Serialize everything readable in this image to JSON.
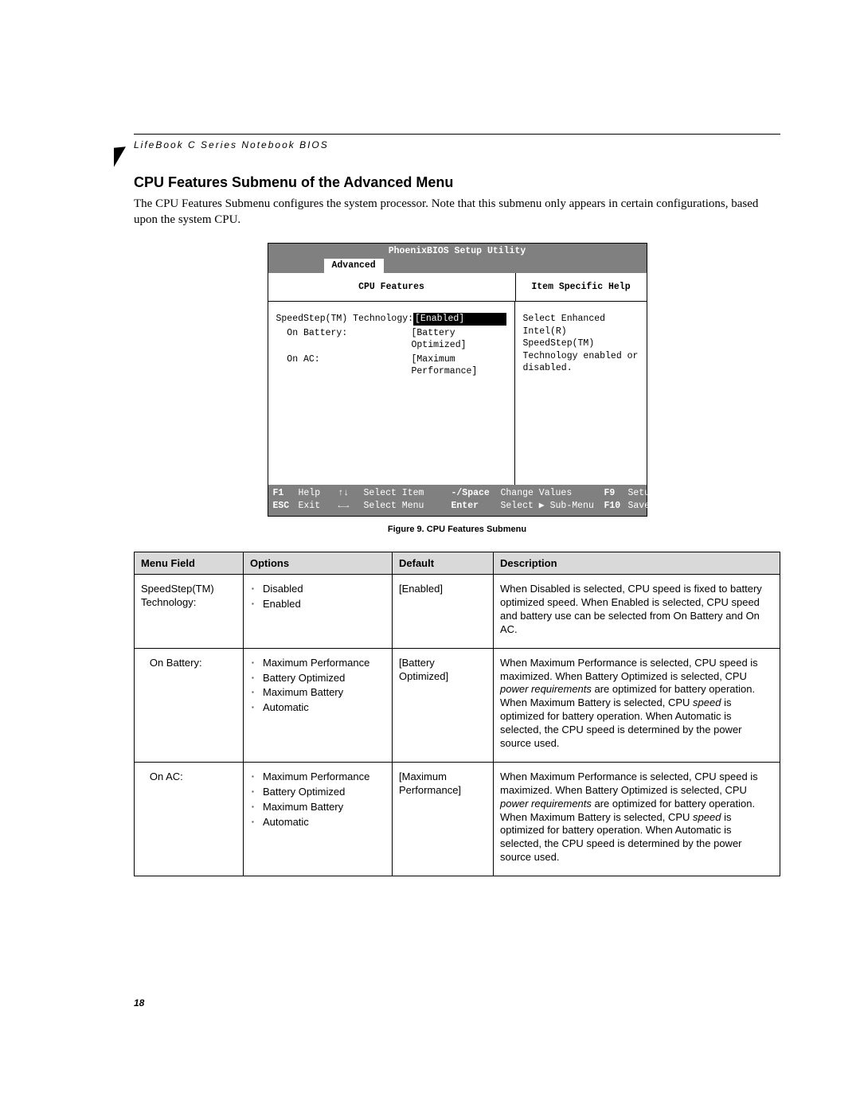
{
  "running_header": "LifeBook C Series Notebook BIOS",
  "section_title": "CPU Features Submenu of the Advanced Menu",
  "lead_paragraph": "The CPU Features Submenu configures the system processor. Note that this submenu only appears in certain configurations, based upon the system CPU.",
  "page_number": "18",
  "bios": {
    "title": "PhoenixBIOS Setup Utility",
    "active_tab": "Advanced",
    "left_heading": "CPU Features",
    "right_heading": "Item Specific Help",
    "settings": [
      {
        "label": "SpeedStep(TM) Technology:",
        "value": "[Enabled]",
        "selected": true
      },
      {
        "label": "  On Battery:",
        "value": "[Battery Optimized]",
        "selected": false
      },
      {
        "label": "  On AC:",
        "value": "[Maximum Performance]",
        "selected": false
      }
    ],
    "help_text": "Select Enhanced Intel(R) SpeedStep(TM) Technology enabled or disabled.",
    "footer": {
      "r1": {
        "k1": "F1",
        "l1": "Help",
        "k2": "↑↓",
        "l2": "Select Item",
        "k3": "-/Space",
        "l3": "Change Values",
        "k4": "F9",
        "l4": "Setup Defaults"
      },
      "r2": {
        "k1": "ESC",
        "l1": "Exit",
        "k2": "←→",
        "l2": "Select Menu",
        "k3": "Enter",
        "l3": "Select ▶ Sub-Menu",
        "k4": "F10",
        "l4": "Save and Exit"
      }
    }
  },
  "figure_caption": "Figure 9.  CPU Features Submenu",
  "table": {
    "headers": {
      "menu_field": "Menu Field",
      "options": "Options",
      "default": "Default",
      "description": "Description"
    },
    "rows": [
      {
        "menu_field": "SpeedStep(TM) Technology:",
        "options": [
          "Disabled",
          "Enabled"
        ],
        "default": "[Enabled]",
        "description_plain": "When Disabled is selected, CPU speed is fixed to battery optimized speed. When Enabled is selected, CPU speed and battery use can be selected from On Battery and On AC."
      },
      {
        "menu_field": "   On Battery:",
        "options": [
          "Maximum Performance",
          "Battery Optimized",
          "Maximum Battery",
          "Automatic"
        ],
        "default": "[Battery Optimized]",
        "description_html": "When Maximum Performance is selected, CPU speed is maximized. When Battery Optimized is selected, CPU <span class=\"italic\">power requirements</span> are optimized for battery operation. When Maximum Battery is selected, CPU <span class=\"italic\">speed</span> is optimized for battery operation. When Automatic is selected, the CPU speed is determined by the power source used."
      },
      {
        "menu_field": "   On AC:",
        "options": [
          "Maximum Performance",
          "Battery Optimized",
          "Maximum Battery",
          "Automatic"
        ],
        "default": "[Maximum Performance]",
        "description_html": "When Maximum Performance is selected, CPU speed is maximized. When Battery Optimized is selected, CPU <span class=\"italic\">power requirements</span> are optimized for battery operation. When Maximum Battery is selected, CPU <span class=\"italic\">speed</span> is optimized for battery operation. When Automatic is selected, the CPU speed is determined by the power source used."
      }
    ]
  }
}
